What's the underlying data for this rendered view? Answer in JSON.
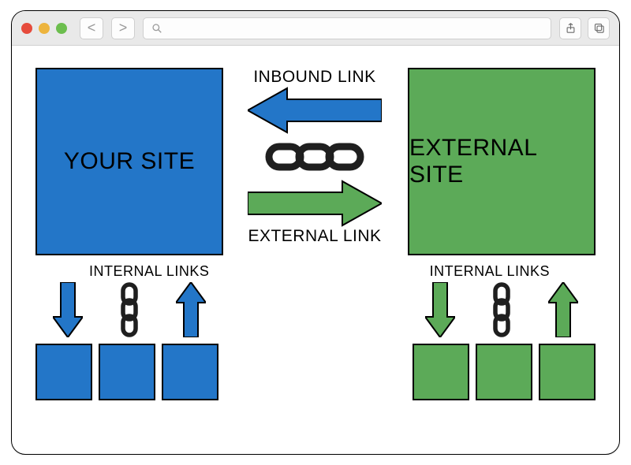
{
  "titlebar": {
    "back_glyph": "<",
    "forward_glyph": ">"
  },
  "diagram": {
    "your_site": "YOUR SITE",
    "external_site": "EXTERNAL SITE",
    "inbound_link": "INBOUND LINK",
    "external_link": "EXTERNAL LINK",
    "internal_links": "INTERNAL LINKS",
    "colors": {
      "blue": "#2376c8",
      "green": "#5caa58"
    }
  }
}
